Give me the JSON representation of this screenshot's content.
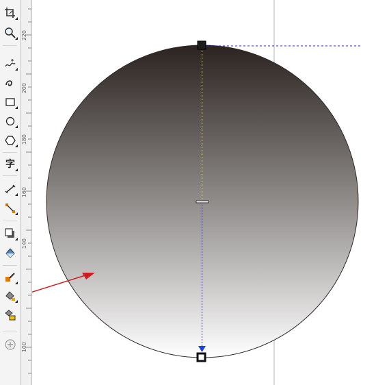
{
  "toolbox": {
    "tools": [
      {
        "id": "crop",
        "name": "crop-tool"
      },
      {
        "id": "zoom",
        "name": "zoom-tool"
      },
      {
        "id": "freehand",
        "name": "freehand-tool"
      },
      {
        "id": "smart-draw",
        "name": "smart-drawing-tool"
      },
      {
        "id": "rectangle",
        "name": "rectangle-tool"
      },
      {
        "id": "ellipse",
        "name": "ellipse-tool"
      },
      {
        "id": "polygon",
        "name": "polygon-tool"
      },
      {
        "id": "text",
        "name": "text-tool",
        "glyph": "字"
      },
      {
        "id": "dimension",
        "name": "dimension-tool"
      },
      {
        "id": "connector",
        "name": "connector-tool"
      },
      {
        "id": "shadow",
        "name": "drop-shadow-tool"
      },
      {
        "id": "transparency",
        "name": "transparency-tool"
      },
      {
        "id": "eyedropper",
        "name": "eyedropper-tool"
      },
      {
        "id": "interactive-fill",
        "name": "interactive-fill-tool",
        "highlighted": true
      },
      {
        "id": "smart-fill",
        "name": "smart-fill-tool"
      },
      {
        "id": "add",
        "name": "add-tool-icon"
      }
    ]
  },
  "ruler": {
    "labels": [
      "220",
      "200",
      "180",
      "160",
      "140",
      "100"
    ]
  },
  "canvas": {
    "gradient_top_color": "#2b2320",
    "gradient_mid_color": "#8f8c8a",
    "gradient_bottom_color": "#ffffff",
    "guide_color": "#2a2ad0",
    "annotation_color": "#cc1f1f"
  }
}
